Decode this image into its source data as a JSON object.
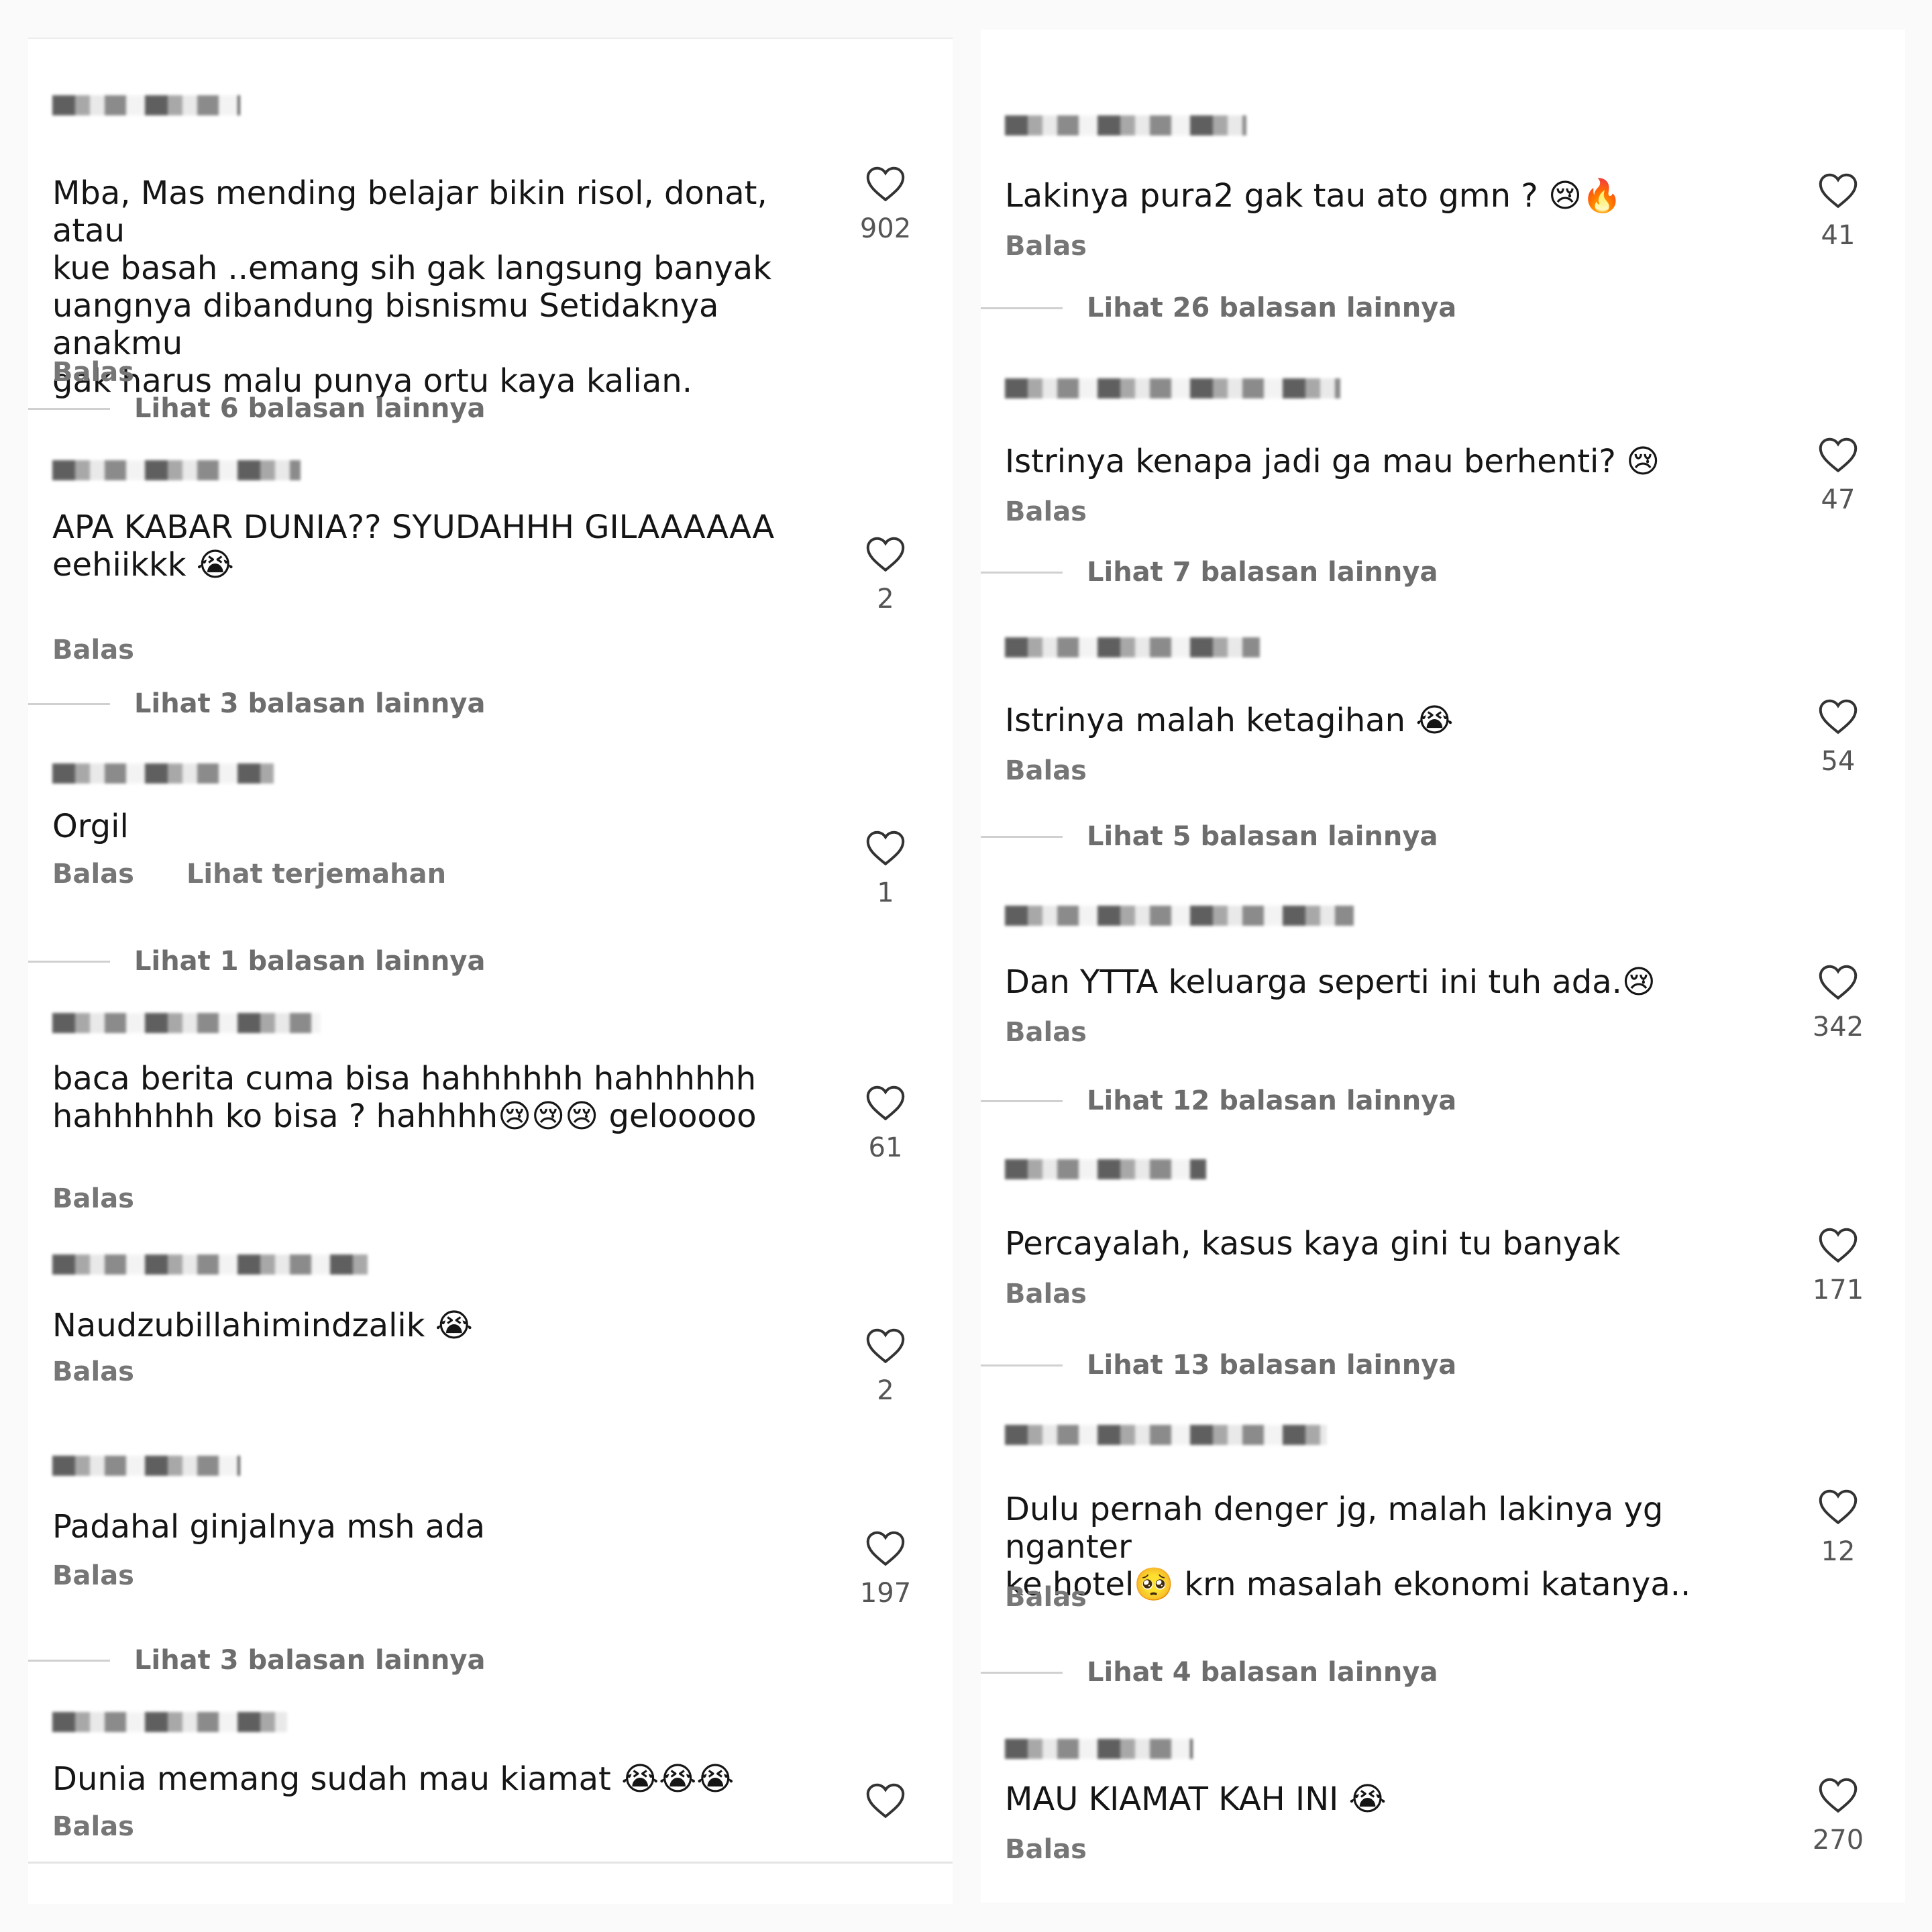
{
  "left": {
    "comments": [
      {
        "text": "Mba, Mas mending belajar bikin risol, donat, atau\nkue basah ..emang sih gak langsung banyak\nuangnya dibandung bisnismu Setidaknya anakmu\ngak harus malu punya ortu kaya kalian.",
        "reply_label": "Balas",
        "likes": "902",
        "more_replies": "Lihat 6 balasan lainnya"
      },
      {
        "text": "APA KABAR DUNIA?? SYUDAHHH GILAAAAAA\neehiikkk 😭",
        "reply_label": "Balas",
        "likes": "2",
        "more_replies": "Lihat 3 balasan lainnya"
      },
      {
        "text": "Orgil",
        "reply_label": "Balas",
        "translate_label": "Lihat terjemahan",
        "likes": "1",
        "more_replies": "Lihat 1 balasan lainnya"
      },
      {
        "text": "baca berita cuma bisa hahhhhhh hahhhhhh\nhahhhhhh ko bisa ? hahhhh😢😢😢 gelooooo",
        "reply_label": "Balas",
        "likes": "61"
      },
      {
        "text": "Naudzubillahimindzalik 😭",
        "reply_label": "Balas",
        "likes": "2"
      },
      {
        "text": "Padahal ginjalnya msh ada",
        "reply_label": "Balas",
        "likes": "197",
        "more_replies": "Lihat 3 balasan lainnya"
      },
      {
        "text": "Dunia memang sudah mau kiamat 😭😭😭",
        "reply_label": "Balas",
        "likes": ""
      }
    ]
  },
  "right": {
    "comments": [
      {
        "text": "Lakinya pura2 gak tau ato gmn ? 😢🔥",
        "reply_label": "Balas",
        "likes": "41",
        "more_replies": "Lihat 26 balasan lainnya"
      },
      {
        "text": "Istrinya kenapa jadi ga mau berhenti? 😢",
        "reply_label": "Balas",
        "likes": "47",
        "more_replies": "Lihat 7 balasan lainnya"
      },
      {
        "text": "Istrinya malah ketagihan 😭",
        "reply_label": "Balas",
        "likes": "54",
        "more_replies": "Lihat 5 balasan lainnya"
      },
      {
        "text": "Dan YTTA keluarga seperti ini tuh ada.😢",
        "reply_label": "Balas",
        "likes": "342",
        "more_replies": "Lihat 12 balasan lainnya"
      },
      {
        "text": "Percayalah, kasus kaya gini tu banyak",
        "reply_label": "Balas",
        "likes": "171",
        "more_replies": "Lihat 13 balasan lainnya"
      },
      {
        "text": "Dulu pernah denger jg, malah lakinya yg nganter\nke hotel🥺 krn masalah ekonomi katanya..",
        "reply_label": "Balas",
        "likes": "12",
        "more_replies": "Lihat 4 balasan lainnya"
      },
      {
        "text": "MAU KIAMAT KAH INI 😭",
        "reply_label": "Balas",
        "likes": "270"
      }
    ]
  },
  "icons": {
    "like": "heart-outline-icon"
  },
  "colors": {
    "background": "#fafafa",
    "panel": "#ffffff",
    "text": "#151515",
    "muted": "#767676",
    "divider": "#d0d0d0"
  }
}
